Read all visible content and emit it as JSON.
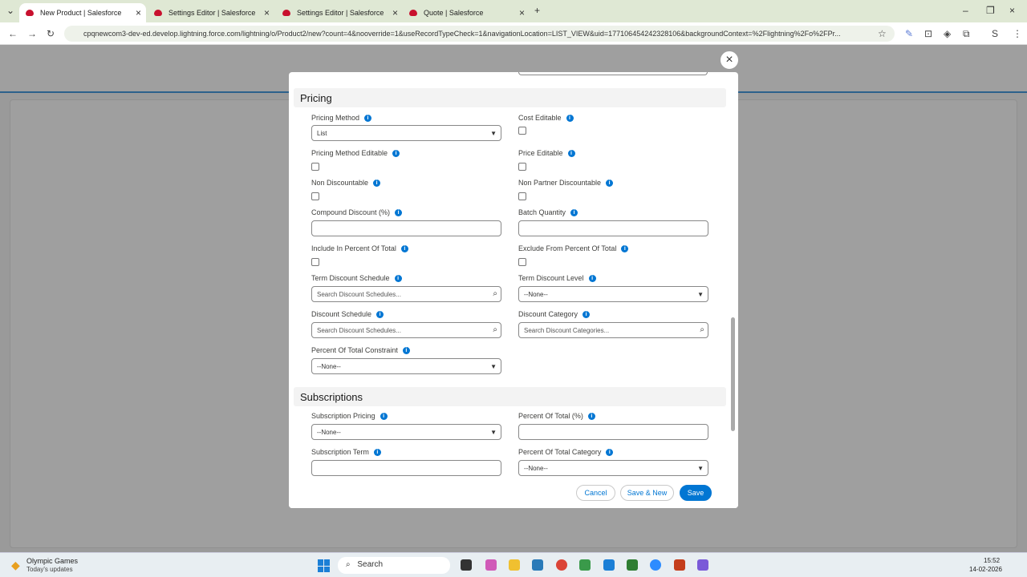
{
  "browser": {
    "tabs": [
      {
        "title": "New Product | Salesforce",
        "active": true
      },
      {
        "title": "Settings Editor | Salesforce",
        "active": false
      },
      {
        "title": "Settings Editor | Salesforce",
        "active": false
      },
      {
        "title": "Quote | Salesforce",
        "active": false
      }
    ],
    "url": "cpqnewcom3-dev-ed.develop.lightning.force.com/lightning/o/Product2/new?count=4&nooverride=1&useRecordTypeCheck=1&navigationLocation=LIST_VIEW&uid=177106454242328106&backgroundContext=%2Flightning%2Fo%2FPr..."
  },
  "modal": {
    "sections": {
      "pricing": "Pricing",
      "subscriptions": "Subscriptions"
    },
    "fields": {
      "pricing_method": {
        "label": "Pricing Method",
        "value": "List"
      },
      "cost_editable": {
        "label": "Cost Editable"
      },
      "pricing_method_editable": {
        "label": "Pricing Method Editable"
      },
      "price_editable": {
        "label": "Price Editable"
      },
      "non_discountable": {
        "label": "Non Discountable"
      },
      "non_partner_discountable": {
        "label": "Non Partner Discountable"
      },
      "compound_discount": {
        "label": "Compound Discount (%)",
        "value": ""
      },
      "batch_quantity": {
        "label": "Batch Quantity",
        "value": ""
      },
      "include_in_percent": {
        "label": "Include In Percent Of Total"
      },
      "exclude_from_percent": {
        "label": "Exclude From Percent Of Total"
      },
      "term_discount_schedule": {
        "label": "Term Discount Schedule",
        "placeholder": "Search Discount Schedules..."
      },
      "term_discount_level": {
        "label": "Term Discount Level",
        "value": "--None--"
      },
      "discount_schedule": {
        "label": "Discount Schedule",
        "placeholder": "Search Discount Schedules..."
      },
      "discount_category": {
        "label": "Discount Category",
        "placeholder": "Search Discount Categories..."
      },
      "percent_total_constraint": {
        "label": "Percent Of Total Constraint",
        "value": "--None--"
      },
      "subscription_pricing": {
        "label": "Subscription Pricing",
        "value": "--None--"
      },
      "percent_of_total": {
        "label": "Percent Of Total (%)",
        "value": ""
      },
      "subscription_term": {
        "label": "Subscription Term",
        "value": ""
      },
      "percent_total_category": {
        "label": "Percent Of Total Category",
        "value": "--None--"
      }
    },
    "footer": {
      "cancel": "Cancel",
      "save_new": "Save & New",
      "save": "Save"
    }
  },
  "taskbar": {
    "widget_title": "Olympic Games",
    "widget_sub": "Today's updates",
    "search": "Search",
    "time": "15:52",
    "date": "14-02-2026"
  }
}
